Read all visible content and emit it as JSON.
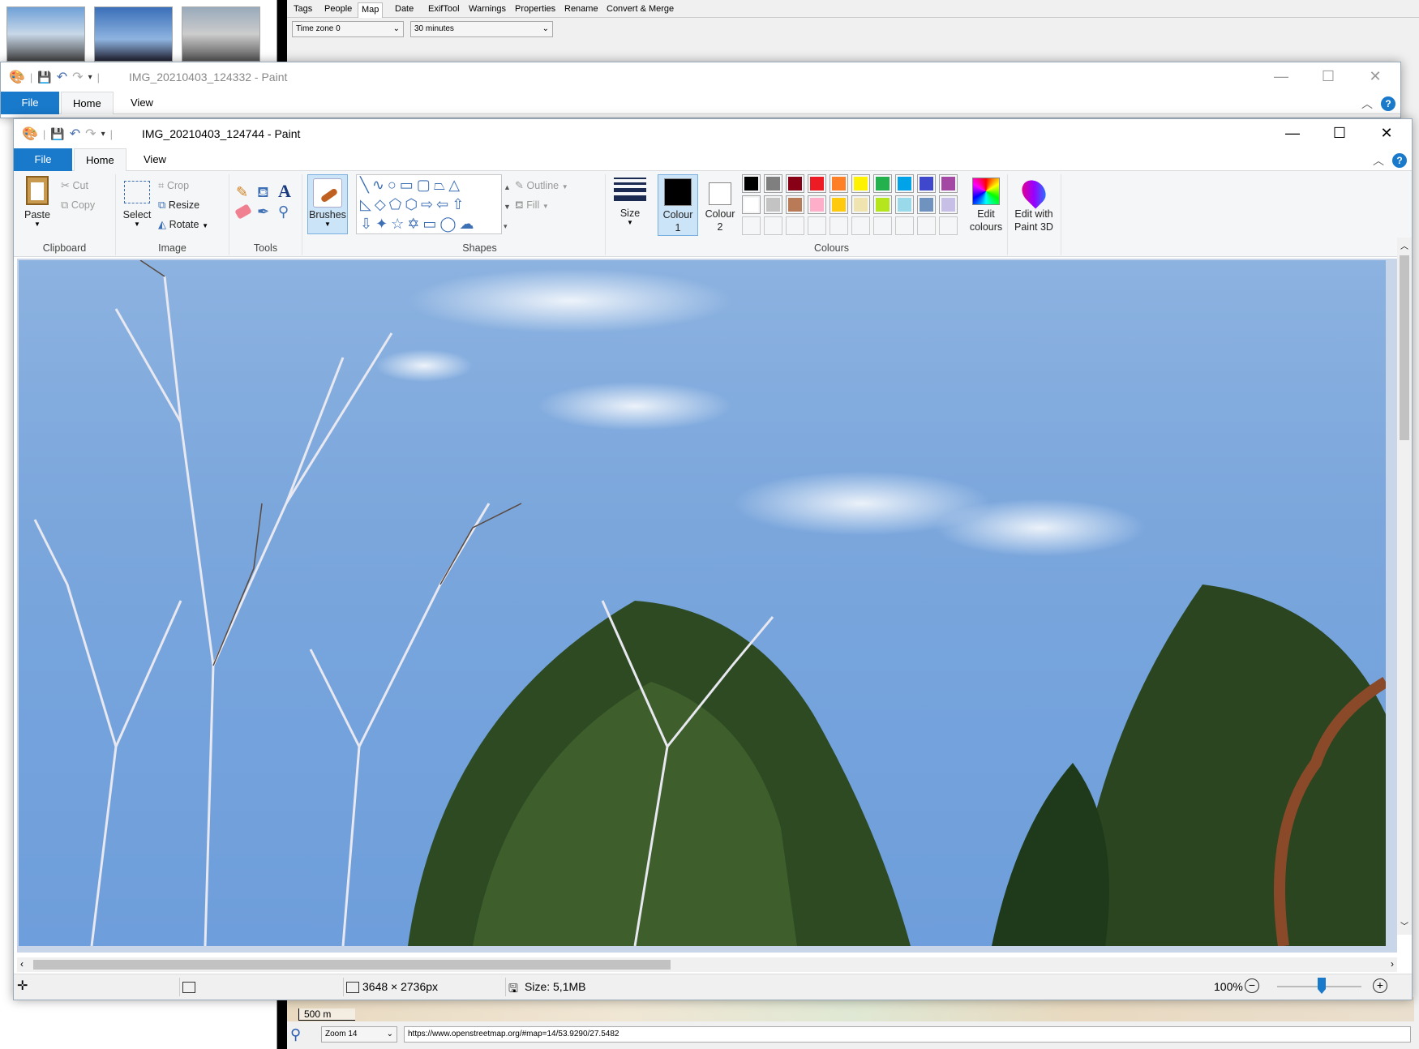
{
  "background_app": {
    "tabs": [
      "Tags",
      "People",
      "Map",
      "Date",
      "ExifTool",
      "Warnings",
      "Properties",
      "Rename",
      "Convert & Merge"
    ],
    "active_tab": "Map",
    "timezone_select": "Time zone 0",
    "interval_select": "30 minutes",
    "map_scale": "500 m",
    "zoom_select": "Zoom 14",
    "map_url": "https://www.openstreetmap.org/#map=14/53.9290/27.5482"
  },
  "paint_back": {
    "title": "IMG_20210403_124332 - Paint",
    "menu": {
      "file": "File",
      "home": "Home",
      "view": "View"
    }
  },
  "paint": {
    "title": "IMG_20210403_124744 - Paint",
    "menu": {
      "file": "File",
      "home": "Home",
      "view": "View"
    },
    "ribbon": {
      "clipboard": {
        "label": "Clipboard",
        "paste": "Paste",
        "cut": "Cut",
        "copy": "Copy"
      },
      "image": {
        "label": "Image",
        "select": "Select",
        "crop": "Crop",
        "resize": "Resize",
        "rotate": "Rotate"
      },
      "tools": {
        "label": "Tools"
      },
      "brushes": "Brushes",
      "shapes": {
        "label": "Shapes",
        "outline": "Outline",
        "fill": "Fill"
      },
      "size": "Size",
      "colours": {
        "label": "Colours",
        "colour1_line1": "Colour",
        "colour1_line2": "1",
        "colour2_line1": "Colour",
        "colour2_line2": "2",
        "edit_line1": "Edit",
        "edit_line2": "colours",
        "paint3d_line1": "Edit with",
        "paint3d_line2": "Paint 3D",
        "colour1": "#000000",
        "colour2": "#ffffff",
        "palette_row1": [
          "#000000",
          "#7f7f7f",
          "#880015",
          "#ed1c24",
          "#ff7f27",
          "#fff200",
          "#22b14c",
          "#00a2e8",
          "#3f48cc",
          "#a349a4"
        ],
        "palette_row2": [
          "#ffffff",
          "#c3c3c3",
          "#b97a57",
          "#ffaec9",
          "#ffc90e",
          "#efe4b0",
          "#b5e61d",
          "#99d9ea",
          "#7092be",
          "#c8bfe7"
        ]
      }
    },
    "status": {
      "dimensions": "3648 × 2736px",
      "size": "Size: 5,1MB",
      "zoom": "100%"
    }
  }
}
